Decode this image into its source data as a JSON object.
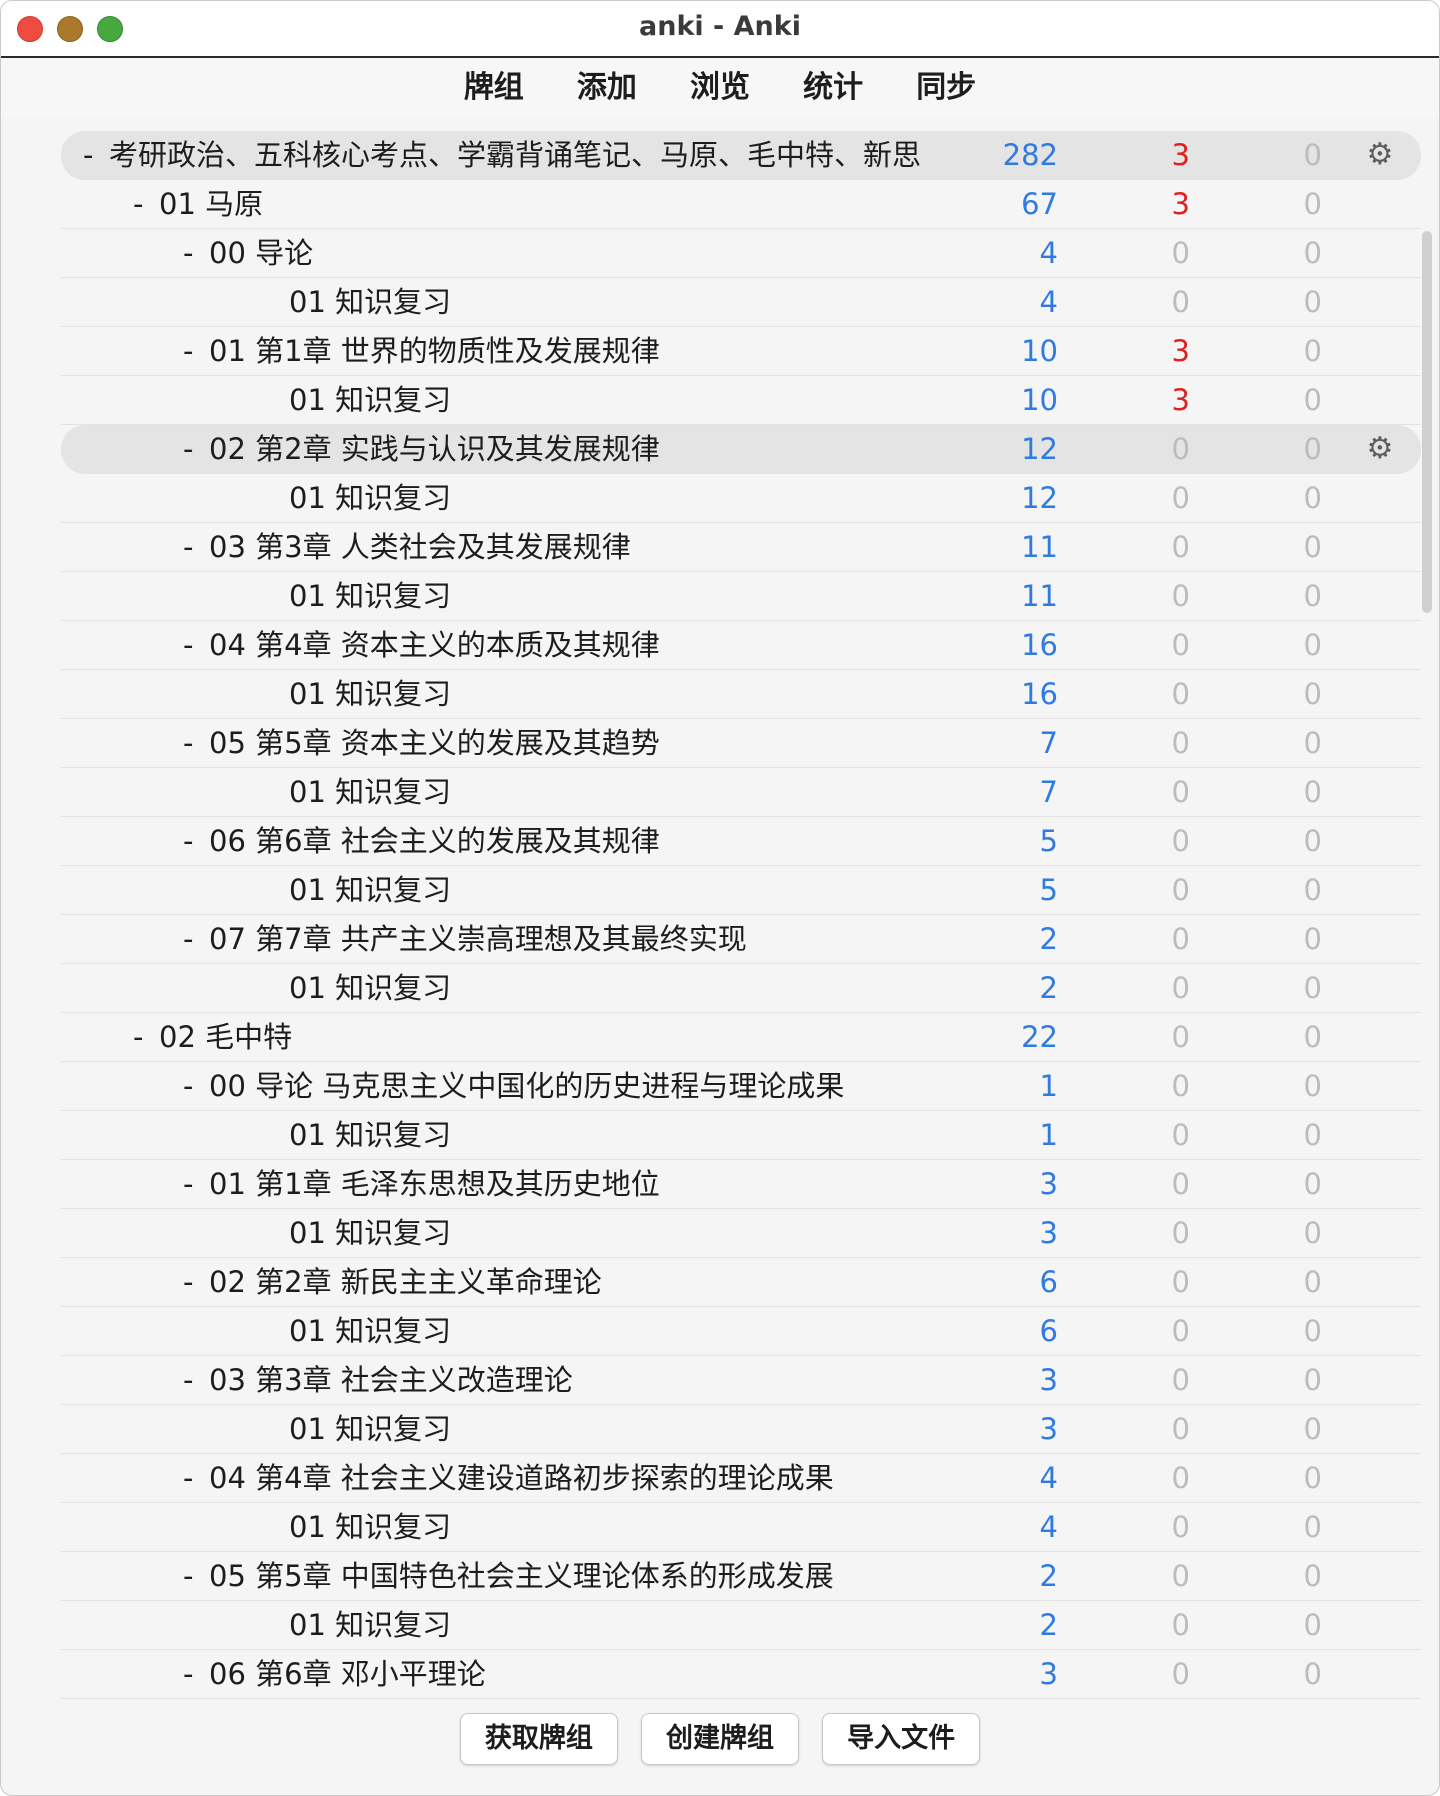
{
  "window": {
    "title": "anki - Anki"
  },
  "toolbar": {
    "tabs": [
      "牌组",
      "添加",
      "浏览",
      "统计",
      "同步"
    ]
  },
  "decks": [
    {
      "name": "考研政治、五科核心考点、学霸背诵笔记、马原、毛中特、新思",
      "depth": 0,
      "collapse": "-",
      "new": "282",
      "learn": "3",
      "due": "0",
      "learn_red": true,
      "highlight": true,
      "gear": true
    },
    {
      "name": "01 马原",
      "depth": 1,
      "collapse": "-",
      "new": "67",
      "learn": "3",
      "due": "0",
      "learn_red": true
    },
    {
      "name": "00 导论",
      "depth": 2,
      "collapse": "-",
      "new": "4",
      "learn": "0",
      "due": "0"
    },
    {
      "name": "01 知识复习",
      "depth": 3,
      "collapse": "",
      "new": "4",
      "learn": "0",
      "due": "0"
    },
    {
      "name": "01 第1章 世界的物质性及发展规律",
      "depth": 2,
      "collapse": "-",
      "new": "10",
      "learn": "3",
      "due": "0",
      "learn_red": true
    },
    {
      "name": "01 知识复习",
      "depth": 3,
      "collapse": "",
      "new": "10",
      "learn": "3",
      "due": "0",
      "learn_red": true
    },
    {
      "name": "02 第2章 实践与认识及其发展规律",
      "depth": 2,
      "collapse": "-",
      "new": "12",
      "learn": "0",
      "due": "0",
      "highlight": true,
      "gear": true
    },
    {
      "name": "01 知识复习",
      "depth": 3,
      "collapse": "",
      "new": "12",
      "learn": "0",
      "due": "0"
    },
    {
      "name": "03 第3章 人类社会及其发展规律",
      "depth": 2,
      "collapse": "-",
      "new": "11",
      "learn": "0",
      "due": "0"
    },
    {
      "name": "01 知识复习",
      "depth": 3,
      "collapse": "",
      "new": "11",
      "learn": "0",
      "due": "0"
    },
    {
      "name": "04 第4章 资本主义的本质及其规律",
      "depth": 2,
      "collapse": "-",
      "new": "16",
      "learn": "0",
      "due": "0"
    },
    {
      "name": "01 知识复习",
      "depth": 3,
      "collapse": "",
      "new": "16",
      "learn": "0",
      "due": "0"
    },
    {
      "name": "05 第5章 资本主义的发展及其趋势",
      "depth": 2,
      "collapse": "-",
      "new": "7",
      "learn": "0",
      "due": "0"
    },
    {
      "name": "01 知识复习",
      "depth": 3,
      "collapse": "",
      "new": "7",
      "learn": "0",
      "due": "0"
    },
    {
      "name": "06 第6章 社会主义的发展及其规律",
      "depth": 2,
      "collapse": "-",
      "new": "5",
      "learn": "0",
      "due": "0"
    },
    {
      "name": "01 知识复习",
      "depth": 3,
      "collapse": "",
      "new": "5",
      "learn": "0",
      "due": "0"
    },
    {
      "name": "07 第7章 共产主义崇高理想及其最终实现",
      "depth": 2,
      "collapse": "-",
      "new": "2",
      "learn": "0",
      "due": "0"
    },
    {
      "name": "01 知识复习",
      "depth": 3,
      "collapse": "",
      "new": "2",
      "learn": "0",
      "due": "0"
    },
    {
      "name": "02 毛中特",
      "depth": 1,
      "collapse": "-",
      "new": "22",
      "learn": "0",
      "due": "0"
    },
    {
      "name": "00 导论 马克思主义中国化的历史进程与理论成果",
      "depth": 2,
      "collapse": "-",
      "new": "1",
      "learn": "0",
      "due": "0"
    },
    {
      "name": "01 知识复习",
      "depth": 3,
      "collapse": "",
      "new": "1",
      "learn": "0",
      "due": "0"
    },
    {
      "name": "01 第1章 毛泽东思想及其历史地位",
      "depth": 2,
      "collapse": "-",
      "new": "3",
      "learn": "0",
      "due": "0"
    },
    {
      "name": "01 知识复习",
      "depth": 3,
      "collapse": "",
      "new": "3",
      "learn": "0",
      "due": "0"
    },
    {
      "name": "02 第2章 新民主主义革命理论",
      "depth": 2,
      "collapse": "-",
      "new": "6",
      "learn": "0",
      "due": "0"
    },
    {
      "name": "01 知识复习",
      "depth": 3,
      "collapse": "",
      "new": "6",
      "learn": "0",
      "due": "0"
    },
    {
      "name": "03 第3章 社会主义改造理论",
      "depth": 2,
      "collapse": "-",
      "new": "3",
      "learn": "0",
      "due": "0"
    },
    {
      "name": "01 知识复习",
      "depth": 3,
      "collapse": "",
      "new": "3",
      "learn": "0",
      "due": "0"
    },
    {
      "name": "04 第4章 社会主义建设道路初步探索的理论成果",
      "depth": 2,
      "collapse": "-",
      "new": "4",
      "learn": "0",
      "due": "0"
    },
    {
      "name": "01 知识复习",
      "depth": 3,
      "collapse": "",
      "new": "4",
      "learn": "0",
      "due": "0"
    },
    {
      "name": "05 第5章 中国特色社会主义理论体系的形成发展",
      "depth": 2,
      "collapse": "-",
      "new": "2",
      "learn": "0",
      "due": "0"
    },
    {
      "name": "01 知识复习",
      "depth": 3,
      "collapse": "",
      "new": "2",
      "learn": "0",
      "due": "0"
    },
    {
      "name": "06 第6章 邓小平理论",
      "depth": 2,
      "collapse": "-",
      "new": "3",
      "learn": "0",
      "due": "0"
    }
  ],
  "bottom_buttons": [
    "获取牌组",
    "创建牌组",
    "导入文件"
  ],
  "colors": {
    "new": "#2f7be0",
    "learn_active": "#e02020",
    "zero": "#bcbcbc",
    "highlight_row": "#e4e4e4"
  },
  "icons": {
    "row_options": "gear-icon"
  }
}
